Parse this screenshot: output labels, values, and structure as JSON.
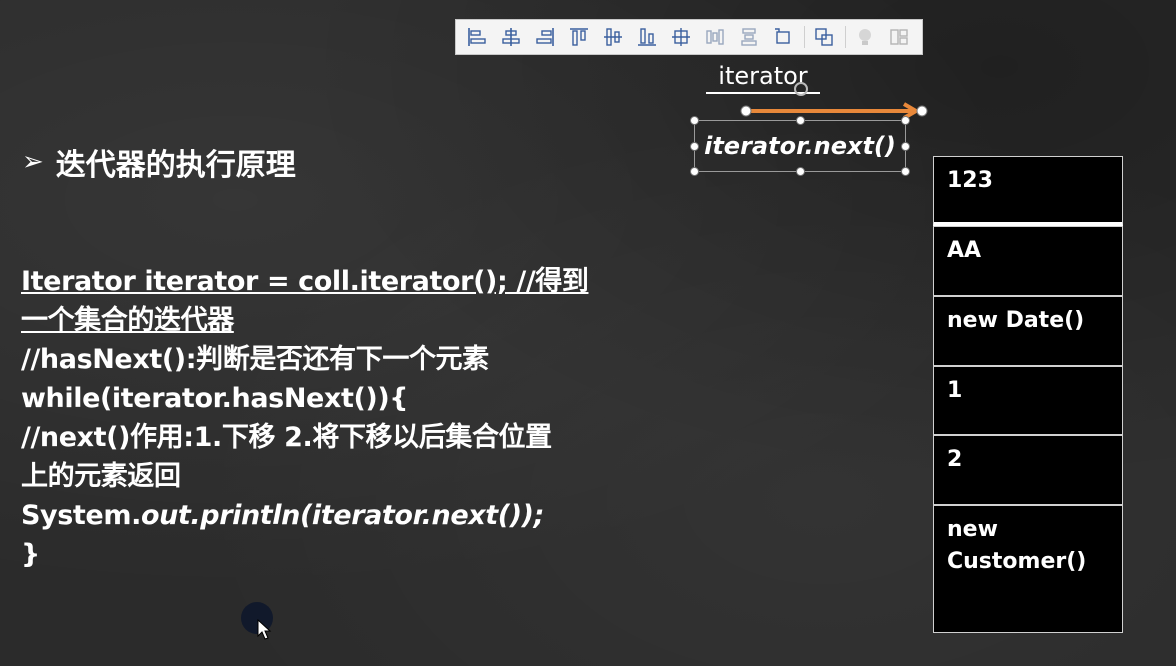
{
  "toolbar": {
    "icons": [
      "align-left-icon",
      "align-center-icon",
      "align-right-icon",
      "align-top-icon",
      "align-middle-icon",
      "align-bottom-icon",
      "distribute-center-icon",
      "distribute-horizontal-icon",
      "distribute-vertical-icon",
      "resize-to-fit-icon",
      "group-icon",
      "lightbulb-icon",
      "arrange-icon"
    ]
  },
  "diagram": {
    "pointer_label": "iterator",
    "method_label": "iterator.next()",
    "arrow_color": "#e8883a"
  },
  "slide": {
    "heading": "迭代器的执行原理",
    "bullet": "➢",
    "code": {
      "line1": "Iterator iterator = coll.iterator(); //得到",
      "line2": "一个集合的迭代器",
      "line3": "//hasNext():判断是否还有下一个元素",
      "line4": "while(iterator.hasNext()){",
      "line5": "//next()作用:1.下移 2.将下移以后集合位置",
      "line6": "上的元素返回",
      "line7_prefix": "System.",
      "line7_italic": "out.println(iterator.next());",
      "line8": "}"
    }
  },
  "collection": {
    "items": [
      "123",
      "AA",
      "new Date()",
      "1",
      "2",
      "new\nCustomer()"
    ]
  }
}
